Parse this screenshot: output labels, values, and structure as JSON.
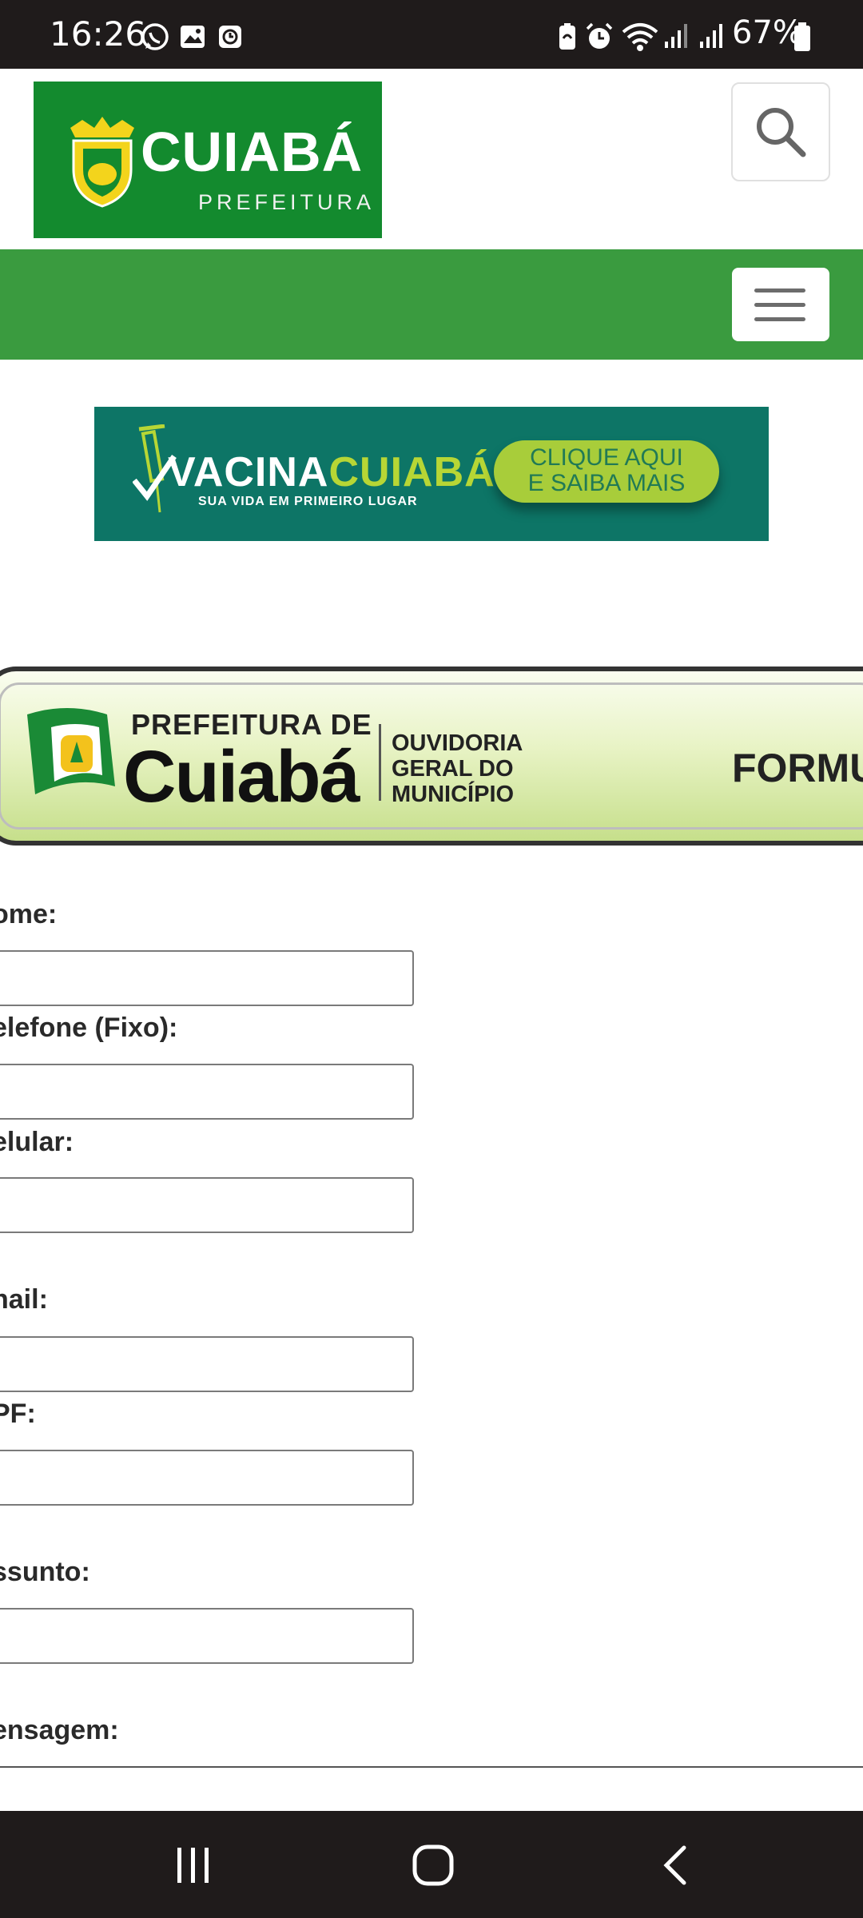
{
  "status_bar": {
    "time": "16:26",
    "battery": "67%",
    "left_icons": [
      "whatsapp-icon",
      "gallery-icon",
      "app-icon"
    ],
    "right_icons": [
      "battery-saver-icon",
      "alarm-icon",
      "wifi-icon",
      "signal-icon",
      "signal-icon",
      "battery-icon"
    ]
  },
  "header": {
    "logo_title": "CUIABÁ",
    "logo_subtitle": "PREFEITURA",
    "search_icon": "search-icon",
    "menu_icon": "hamburger-menu-icon",
    "brand_color": "#138a2e",
    "nav_color": "#3a9b3f"
  },
  "banner": {
    "title_part1": "VACINA",
    "title_part2": "CUIABÁ",
    "tagline": "SUA VIDA EM PRIMEIRO LUGAR",
    "cta_line1": "CLIQUE AQUI",
    "cta_line2": "E SAIBA MAIS",
    "bg_color": "#0d7566"
  },
  "ouvidoria": {
    "prefix": "PREFEITURA DE",
    "city": "Cuiabá",
    "line1": "OUVIDORIA",
    "line2": "GERAL DO",
    "line3": "MUNICÍPIO",
    "form_title_visible": "FORMUL"
  },
  "form": {
    "nome_label": "ome:",
    "telefone_label": "elefone (Fixo):",
    "celular_label": "elular:",
    "email_label": "nail:",
    "cpf_label": "PF:",
    "assunto_label": "ssunto:",
    "mensagem_label": "ensagem:",
    "nome_value": "",
    "telefone_value": "",
    "celular_value": "",
    "email_value": "",
    "cpf_value": "",
    "assunto_value": ""
  },
  "nav_bar": {
    "recents_icon": "recents-icon",
    "home_icon": "home-icon",
    "back_icon": "back-icon"
  }
}
